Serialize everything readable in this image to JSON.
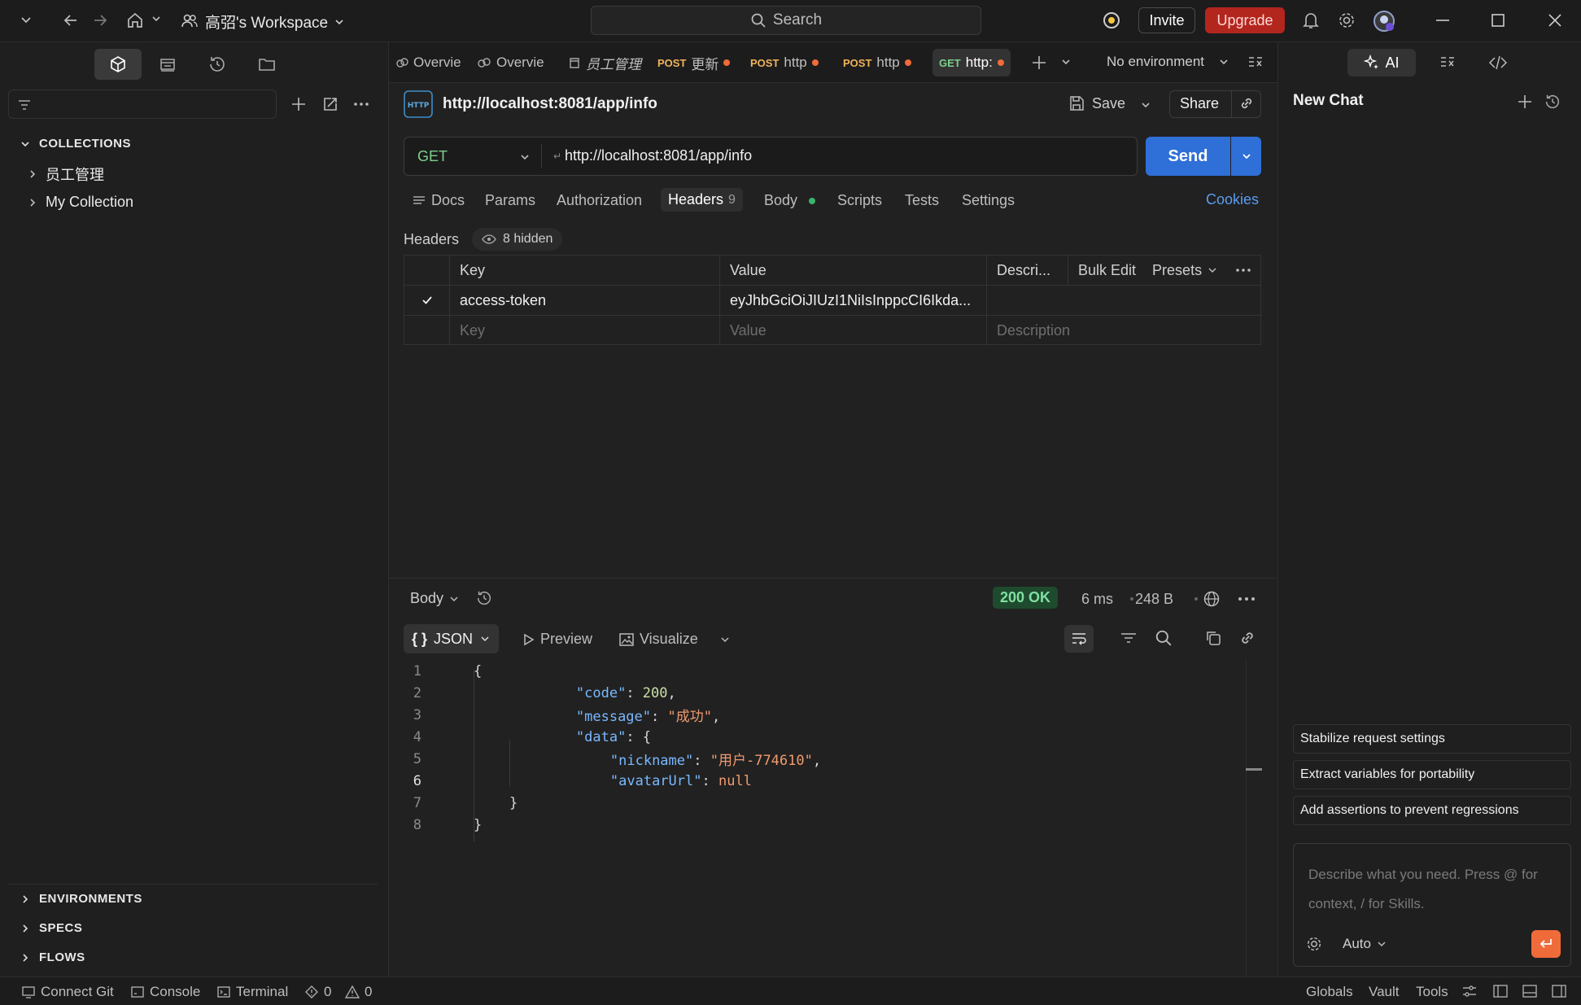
{
  "topbar": {
    "workspace": "高弨's Workspace",
    "search_label": "Search",
    "invite": "Invite",
    "upgrade": "Upgrade"
  },
  "sidebar": {
    "collections_label": "COLLECTIONS",
    "collections": [
      "员工管理",
      "My Collection"
    ],
    "environments_label": "ENVIRONMENTS",
    "specs_label": "SPECS",
    "flows_label": "FLOWS"
  },
  "tabs": [
    {
      "method": "",
      "label": "Overvie"
    },
    {
      "method": "",
      "label": "Overvie"
    },
    {
      "method": "",
      "label": "员工管理"
    },
    {
      "method": "POST",
      "label": "更新"
    },
    {
      "method": "POST",
      "label": "http"
    },
    {
      "method": "POST",
      "label": "http"
    },
    {
      "method": "GET",
      "label": "http:"
    }
  ],
  "environment": "No environment",
  "request": {
    "title": "http://localhost:8081/app/info",
    "save": "Save",
    "share": "Share",
    "method": "GET",
    "url": "http://localhost:8081/app/info",
    "send": "Send",
    "tabs": {
      "docs": "Docs",
      "params": "Params",
      "authorization": "Authorization",
      "headers": "Headers",
      "headers_count": "9",
      "body": "Body",
      "scripts": "Scripts",
      "tests": "Tests",
      "settings": "Settings"
    },
    "cookies": "Cookies",
    "headers_label": "Headers",
    "hidden": "8 hidden",
    "table": {
      "col_key": "Key",
      "col_value": "Value",
      "col_desc": "Descri...",
      "bulk_edit": "Bulk Edit",
      "presets": "Presets",
      "row_key": "access-token",
      "row_value": "eyJhbGciOiJIUzI1NiIsInppcCI6Ikda...",
      "ph_key": "Key",
      "ph_value": "Value",
      "ph_desc": "Description"
    }
  },
  "response": {
    "body_label": "Body",
    "status": "200 OK",
    "time": "6 ms",
    "size": "248 B",
    "format": "JSON",
    "preview": "Preview",
    "visualize": "Visualize",
    "lines": [
      "1",
      "2",
      "3",
      "4",
      "5",
      "6",
      "7",
      "8"
    ],
    "code": {
      "open": "{",
      "code_key": "\"code\"",
      "code_val": "200",
      "message_key": "\"message\"",
      "message_val": "\"成功\"",
      "data_key": "\"data\"",
      "nickname_key": "\"nickname\"",
      "nickname_val": "\"用户-774610\"",
      "avatar_key": "\"avatarUrl\"",
      "avatar_val": "null",
      "inner_close": "}",
      "close": "}"
    }
  },
  "ai_panel": {
    "tab_ai": "AI",
    "title": "New Chat",
    "suggestions": [
      "Stabilize request settings",
      "Extract variables for portability",
      "Add assertions to prevent regressions"
    ],
    "placeholder_1": "Describe what you need. Press @ for",
    "placeholder_2": "context, / for Skills.",
    "mode": "Auto"
  },
  "statusbar": {
    "connect_git": "Connect Git",
    "console": "Console",
    "terminal": "Terminal",
    "errors": "0",
    "warnings": "0",
    "globals": "Globals",
    "vault": "Vault",
    "tools": "Tools"
  }
}
